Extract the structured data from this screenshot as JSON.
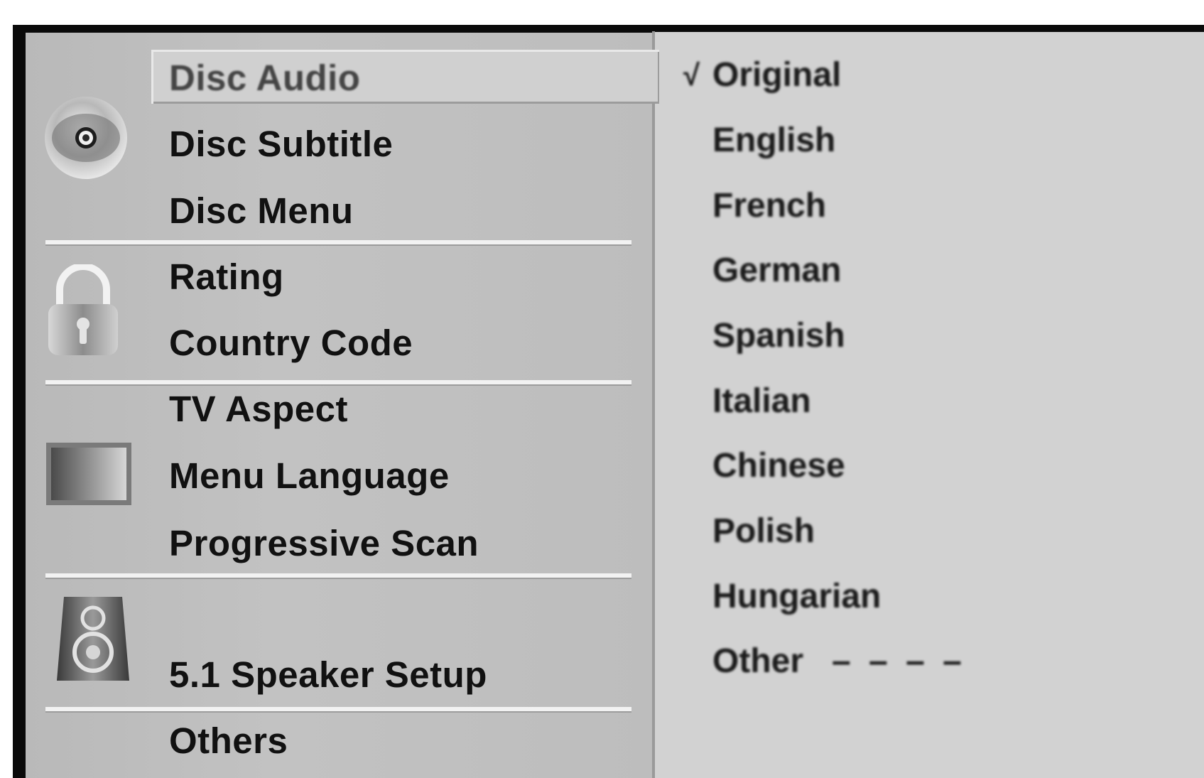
{
  "menu": {
    "items": [
      {
        "label": "Disc Audio"
      },
      {
        "label": "Disc Subtitle"
      },
      {
        "label": "Disc Menu"
      },
      {
        "label": "Rating"
      },
      {
        "label": "Country Code"
      },
      {
        "label": "TV Aspect"
      },
      {
        "label": "Menu Language"
      },
      {
        "label": "Progressive Scan"
      },
      {
        "label": "5.1 Speaker Setup"
      },
      {
        "label": "Others"
      }
    ],
    "selected_index": 0
  },
  "options": {
    "checkmark": "√",
    "items": [
      {
        "label": "Original"
      },
      {
        "label": "English"
      },
      {
        "label": "French"
      },
      {
        "label": "German"
      },
      {
        "label": "Spanish"
      },
      {
        "label": "Italian"
      },
      {
        "label": "Chinese"
      },
      {
        "label": "Polish"
      },
      {
        "label": "Hungarian"
      },
      {
        "label": "Other",
        "suffix": "– – – –"
      }
    ],
    "checked_index": 0
  },
  "icons": {
    "language": "disc-icon",
    "lock": "padlock-icon",
    "display": "tv-screen-icon",
    "audio": "speaker-icon"
  },
  "colors": {
    "menu_bg": "#bdbdbd",
    "options_bg": "#d2d2d2",
    "highlight_bg": "#d0d0d0",
    "text": "#111111",
    "frame": "#0a0a0a"
  }
}
